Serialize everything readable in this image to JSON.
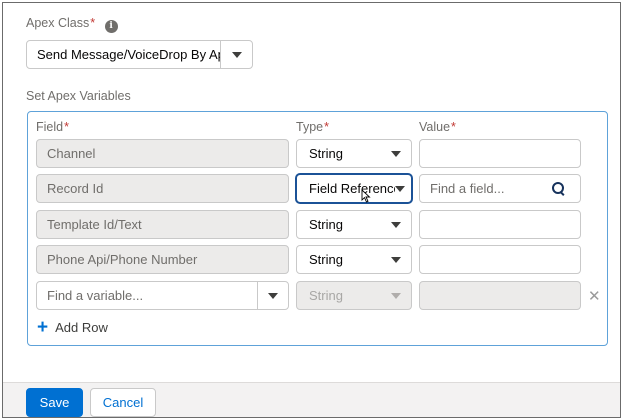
{
  "apex_class": {
    "label": "Apex Class",
    "required_marker": "*",
    "info_icon": "info-icon",
    "selected_value": "Send Message/VoiceDrop By Apex"
  },
  "variables": {
    "section_label": "Set Apex Variables",
    "headers": {
      "field": "Field",
      "type": "Type",
      "value": "Value",
      "required_marker": "*"
    },
    "rows": [
      {
        "field": "Channel",
        "type": "String",
        "value": ""
      },
      {
        "field": "Record Id",
        "type": "Field Reference",
        "value_placeholder": "Find a field..."
      },
      {
        "field": "Template Id/Text",
        "type": "String",
        "value": ""
      },
      {
        "field": "Phone Api/Phone Number",
        "type": "String",
        "value": ""
      }
    ],
    "new_row": {
      "field_placeholder": "Find a variable...",
      "type": "String"
    },
    "add_row_label": "Add Row"
  },
  "footer": {
    "save_label": "Save",
    "cancel_label": "Cancel"
  },
  "colors": {
    "brand": "#0070d2",
    "focus_border": "#5ea2d9",
    "required": "#c23934"
  }
}
